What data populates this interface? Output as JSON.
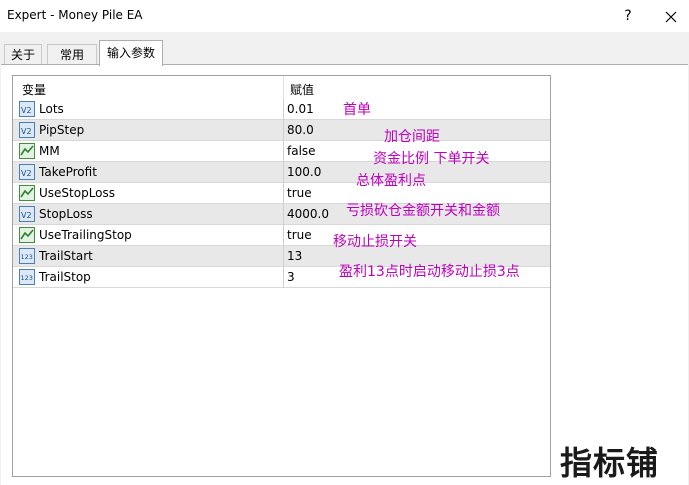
{
  "window": {
    "title": "Expert - Money Pile EA",
    "help": "?"
  },
  "tabs": [
    {
      "label": "关于"
    },
    {
      "label": "常用"
    },
    {
      "label": "输入参数",
      "active": true
    }
  ],
  "table": {
    "headers": {
      "variable": "变量",
      "value": "赋值"
    },
    "rows": [
      {
        "name": "Lots",
        "value": "0.01",
        "icon": "value-param-icon"
      },
      {
        "name": "PipStep",
        "value": "80.0",
        "icon": "value-param-icon"
      },
      {
        "name": "MM",
        "value": "false",
        "icon": "bool-param-icon"
      },
      {
        "name": "TakeProfit",
        "value": "100.0",
        "icon": "value-param-icon"
      },
      {
        "name": "UseStopLoss",
        "value": "true",
        "icon": "bool-param-icon"
      },
      {
        "name": "StopLoss",
        "value": "4000.0",
        "icon": "value-param-icon"
      },
      {
        "name": "UseTrailingStop",
        "value": "true",
        "icon": "bool-param-icon"
      },
      {
        "name": "TrailStart",
        "value": "13",
        "icon": "int-param-icon"
      },
      {
        "name": "TrailStop",
        "value": "3",
        "icon": "int-param-icon"
      }
    ]
  },
  "annotations": [
    "首单",
    "加仓间距",
    "资金比例 下单开关",
    "总体盈利点",
    "亏损砍仓金额开关和金额",
    "移动止损开关",
    "盈利13点时启动移动止损3点"
  ],
  "watermark": "指标铺",
  "colors": {
    "annotation": "#c000c0",
    "row_alt": "#e8e8e8",
    "border": "#a0a0a0"
  }
}
